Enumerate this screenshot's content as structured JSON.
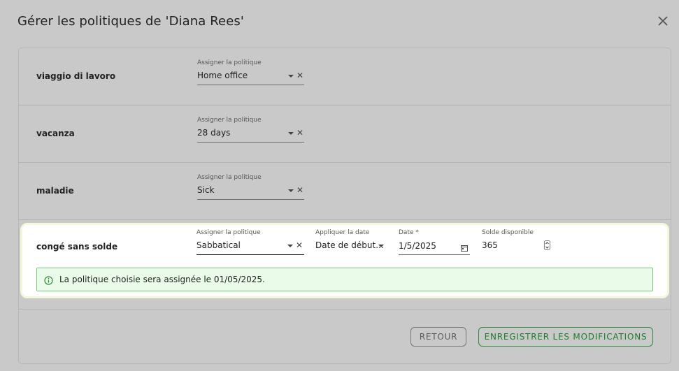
{
  "dialog": {
    "title": "Gérer les politiques de 'Diana Rees'"
  },
  "rows": [
    {
      "label": "viaggio di lavoro",
      "policy_label": "Assigner la politique",
      "policy_value": "Home office"
    },
    {
      "label": "vacanza",
      "policy_label": "Assigner la politique",
      "policy_value": "28 days"
    },
    {
      "label": "maladie",
      "policy_label": "Assigner la politique",
      "policy_value": "Sick"
    },
    {
      "label": "congé sans solde",
      "policy_label": "Assigner la politique",
      "policy_value": "Sabbatical",
      "apply_label": "Appliquer la date",
      "apply_value": "Date de début...",
      "date_label": "Date *",
      "date_value": "1/5/2025",
      "balance_label": "Solde disponible",
      "balance_value": "365"
    }
  ],
  "info_message": "La politique choisie sera assignée le 01/05/2025.",
  "buttons": {
    "back": "RETOUR",
    "save": "ENREGISTRER LES MODIFICATIONS"
  },
  "colors": {
    "overlay": "#c9c9c9",
    "success_green": "#1e7d2d",
    "info_bg": "#eafbea"
  },
  "icons": [
    "close-icon",
    "dropdown-caret-icon",
    "clear-icon",
    "calendar-icon",
    "spinner-icon",
    "info-icon"
  ]
}
